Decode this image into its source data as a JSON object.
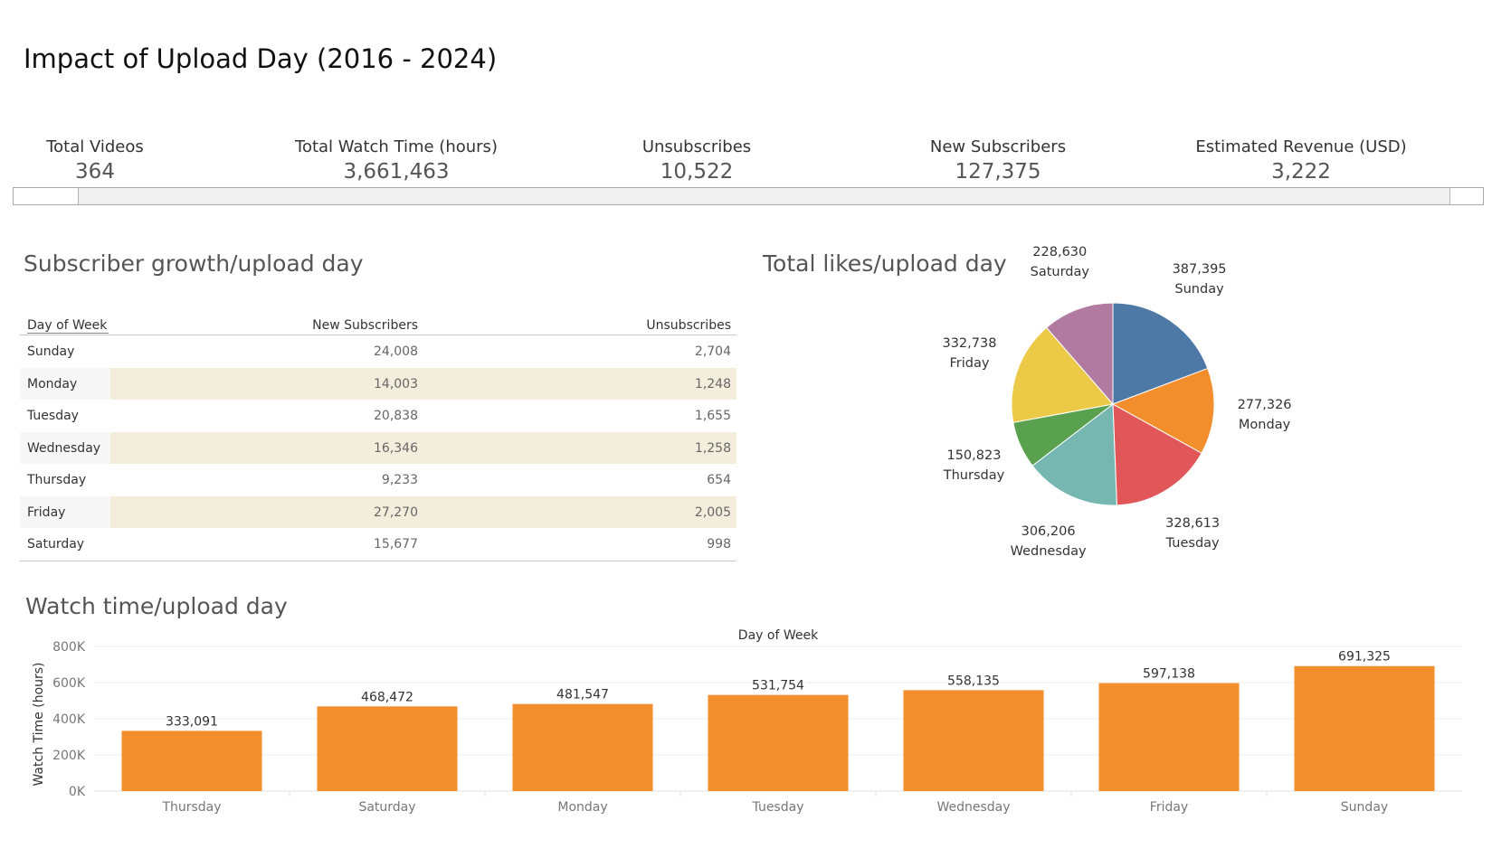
{
  "title": "Impact of Upload Day (2016 - 2024)",
  "kpis": [
    {
      "label": "Total Videos",
      "value": "364"
    },
    {
      "label": "Total Watch Time (hours)",
      "value": "3,661,463"
    },
    {
      "label": "Unsubscribes",
      "value": "10,522"
    },
    {
      "label": "New Subscribers",
      "value": "127,375"
    },
    {
      "label": "Estimated Revenue (USD)",
      "value": "3,222"
    }
  ],
  "subscriber_section": {
    "title": "Subscriber growth/upload day",
    "columns": [
      "Day of Week",
      "New Subscribers",
      "Unsubscribes"
    ],
    "rows": [
      {
        "day": "Sunday",
        "new": "24,008",
        "unsub": "2,704"
      },
      {
        "day": "Monday",
        "new": "14,003",
        "unsub": "1,248"
      },
      {
        "day": "Tuesday",
        "new": "20,838",
        "unsub": "1,655"
      },
      {
        "day": "Wednesday",
        "new": "16,346",
        "unsub": "1,258"
      },
      {
        "day": "Thursday",
        "new": "9,233",
        "unsub": "654"
      },
      {
        "day": "Friday",
        "new": "27,270",
        "unsub": "2,005"
      },
      {
        "day": "Saturday",
        "new": "15,677",
        "unsub": "998"
      }
    ],
    "shade_color": "#f3eddc"
  },
  "likes_section": {
    "title": "Total likes/upload day"
  },
  "watch_section": {
    "title": "Watch time/upload day"
  },
  "chart_data": [
    {
      "type": "table",
      "title": "Subscriber growth/upload day",
      "columns": [
        "Day of Week",
        "New Subscribers",
        "Unsubscribes"
      ],
      "categories": [
        "Sunday",
        "Monday",
        "Tuesday",
        "Wednesday",
        "Thursday",
        "Friday",
        "Saturday"
      ],
      "series": [
        {
          "name": "New Subscribers",
          "values": [
            24008,
            14003,
            20838,
            16346,
            9233,
            27270,
            15677
          ]
        },
        {
          "name": "Unsubscribes",
          "values": [
            2704,
            1248,
            1655,
            1258,
            654,
            2005,
            998
          ]
        }
      ]
    },
    {
      "type": "pie",
      "title": "Total likes/upload day",
      "categories": [
        "Sunday",
        "Monday",
        "Tuesday",
        "Wednesday",
        "Thursday",
        "Friday",
        "Saturday"
      ],
      "values": [
        387395,
        277326,
        328613,
        306206,
        150823,
        332738,
        228630
      ],
      "value_labels": [
        "387,395",
        "277,326",
        "328,613",
        "306,206",
        "150,823",
        "332,738",
        "228,630"
      ],
      "colors": [
        "#4e79a7",
        "#f28e2b",
        "#e15759",
        "#76b7b2",
        "#59a14f",
        "#edc948",
        "#b07aa1"
      ]
    },
    {
      "type": "bar",
      "title": "Watch time/upload day",
      "xlabel": "Day of Week",
      "ylabel": "Watch Time (hours)",
      "categories": [
        "Thursday",
        "Saturday",
        "Monday",
        "Tuesday",
        "Wednesday",
        "Friday",
        "Sunday"
      ],
      "values": [
        333091,
        468472,
        481547,
        531754,
        558135,
        597138,
        691325
      ],
      "value_labels": [
        "333,091",
        "468,472",
        "481,547",
        "531,754",
        "558,135",
        "597,138",
        "691,325"
      ],
      "yticks": [
        "0K",
        "200K",
        "400K",
        "600K",
        "800K"
      ],
      "ylim": [
        0,
        800000
      ],
      "bar_color": "#f28e2b",
      "grid": true
    }
  ]
}
